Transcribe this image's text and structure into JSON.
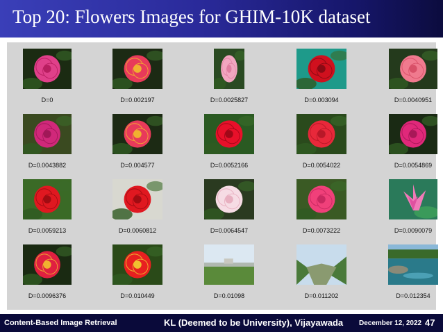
{
  "slide": {
    "title": "Top 20: Flowers Images for GHIM-10K dataset"
  },
  "results": [
    {
      "label": "D=0",
      "kind": "rose",
      "petal": "#e0408a",
      "center": "#b81e60",
      "bg": "#1b2b12"
    },
    {
      "label": "D=0.002197",
      "kind": "rose",
      "petal": "#e83a5a",
      "center": "#f0b030",
      "bg": "#1c2a14"
    },
    {
      "label": "D=0.0025827",
      "kind": "rose",
      "petal": "#f2a6c0",
      "center": "#e07ea0",
      "bg": "#2a4a22"
    },
    {
      "label": "D=0.003094",
      "kind": "rose",
      "petal": "#d0101e",
      "center": "#8a0a14",
      "bg": "#1e9a8a"
    },
    {
      "label": "D=0.0040951",
      "kind": "rose",
      "petal": "#f07a8e",
      "center": "#d85068",
      "bg": "#243a1c"
    },
    {
      "label": "D=0.0043882",
      "kind": "rose",
      "petal": "#d0287a",
      "center": "#a01858",
      "bg": "#3a4a20"
    },
    {
      "label": "D=0.004577",
      "kind": "rose",
      "petal": "#e83a5a",
      "center": "#f0b030",
      "bg": "#1c2a14"
    },
    {
      "label": "D=0.0052166",
      "kind": "rose",
      "petal": "#e8102a",
      "center": "#a00818",
      "bg": "#2a5a22"
    },
    {
      "label": "D=0.0054022",
      "kind": "rose",
      "petal": "#e8283a",
      "center": "#b81828",
      "bg": "#2a4a1c"
    },
    {
      "label": "D=0.0054869",
      "kind": "rose",
      "petal": "#e0287a",
      "center": "#a81858",
      "bg": "#1a2a14"
    },
    {
      "label": "D=0.0059213",
      "kind": "rose",
      "petal": "#e01820",
      "center": "#a00c12",
      "bg": "#3a6a26"
    },
    {
      "label": "D=0.0060812",
      "kind": "rose",
      "petal": "#e01820",
      "center": "#a00c12",
      "bg": "#d8d8d0"
    },
    {
      "label": "D=0.0064547",
      "kind": "rose",
      "petal": "#f6dce4",
      "center": "#e8b0c0",
      "bg": "#2a3a20"
    },
    {
      "label": "D=0.0073222",
      "kind": "rose",
      "petal": "#f0407a",
      "center": "#c82860",
      "bg": "#3a5a24"
    },
    {
      "label": "D=0.0090079",
      "kind": "lotus",
      "petal": "#f07ab8",
      "center": "#e050a0",
      "bg": "#2a7a5a"
    },
    {
      "label": "D=0.0096376",
      "kind": "rose",
      "petal": "#e02040",
      "center": "#f0b030",
      "bg": "#1a2a12"
    },
    {
      "label": "D=0.010449",
      "kind": "rose",
      "petal": "#e82020",
      "center": "#f0c030",
      "bg": "#2a4a18"
    },
    {
      "label": "D=0.01098",
      "kind": "landscape",
      "sky": "#dce8f2",
      "land": "#5a8a3a",
      "accent": "#b0b8b0"
    },
    {
      "label": "D=0.011202",
      "kind": "valley",
      "sky": "#c8dcec",
      "land": "#4a7a3a",
      "accent": "#8a9a70"
    },
    {
      "label": "D=0.012354",
      "kind": "lake",
      "sky": "#8ab8d8",
      "land": "#2a7a8a",
      "accent": "#3a6a2a"
    }
  ],
  "footer": {
    "course": "Content-Based Image Retrieval",
    "university": "KL (Deemed to be University), Vijayawada",
    "date": "December 12, 2022",
    "page": "47"
  }
}
